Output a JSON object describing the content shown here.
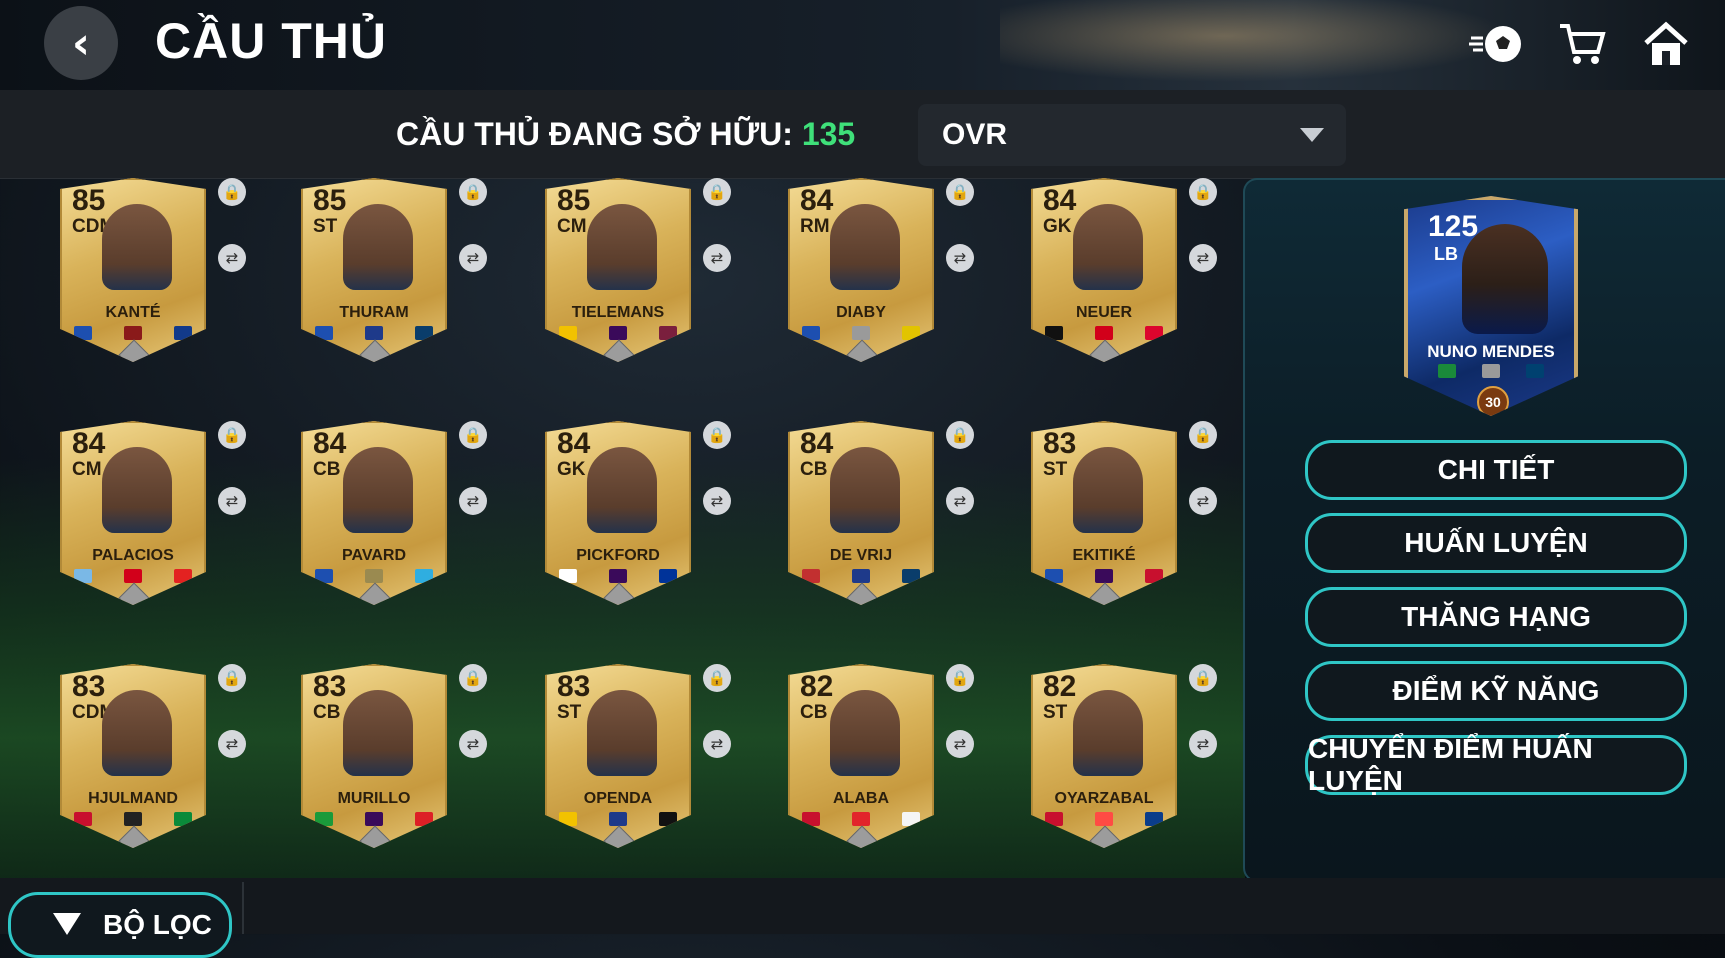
{
  "header": {
    "title": "CẦU THỦ",
    "back_icon": "‹",
    "icons": [
      "football-icon",
      "cart-icon",
      "home-icon"
    ]
  },
  "subbar": {
    "owned_label": "CẦU THỦ ĐANG SỞ HỮU: ",
    "owned_count": "135",
    "sort_value": "OVR"
  },
  "cards": [
    {
      "ovr": "85",
      "pos": "CDM",
      "name": "KANTÉ",
      "flag": "#1d4fb0"
    },
    {
      "ovr": "85",
      "pos": "ST",
      "name": "THURAM",
      "flag": "#1d4fb0"
    },
    {
      "ovr": "85",
      "pos": "CM",
      "name": "TIELEMANS",
      "flag": "#f2c200"
    },
    {
      "ovr": "84",
      "pos": "RM",
      "name": "DIABY",
      "flag": "#1d4fb0"
    },
    {
      "ovr": "84",
      "pos": "GK",
      "name": "NEUER",
      "flag": "#111111"
    },
    {
      "ovr": "84",
      "pos": "CM",
      "name": "PALACIOS",
      "flag": "#7ab8e6"
    },
    {
      "ovr": "84",
      "pos": "CB",
      "name": "PAVARD",
      "flag": "#1d4fb0"
    },
    {
      "ovr": "84",
      "pos": "GK",
      "name": "PICKFORD",
      "flag": "#ffffff"
    },
    {
      "ovr": "84",
      "pos": "CB",
      "name": "DE VRIJ",
      "flag": "#c23030"
    },
    {
      "ovr": "83",
      "pos": "ST",
      "name": "EKITIKÉ",
      "flag": "#1d4fb0"
    },
    {
      "ovr": "83",
      "pos": "CDM",
      "name": "HJULMAND",
      "flag": "#c8102e"
    },
    {
      "ovr": "83",
      "pos": "CB",
      "name": "MURILLO",
      "flag": "#1a9a3a"
    },
    {
      "ovr": "83",
      "pos": "ST",
      "name": "OPENDA",
      "flag": "#f2c200"
    },
    {
      "ovr": "82",
      "pos": "CB",
      "name": "ALABA",
      "flag": "#c8102e"
    },
    {
      "ovr": "82",
      "pos": "ST",
      "name": "OYARZABAL",
      "flag": "#c8102e"
    }
  ],
  "selected": {
    "ovr": "125",
    "pos": "LB",
    "name": "NUNO MENDES",
    "level": "30",
    "flag": "#1a8a3a"
  },
  "actions": [
    "CHI TIẾT",
    "HUẤN LUYỆN",
    "THĂNG HẠNG",
    "ĐIỂM KỸ NĂNG",
    "CHUYỂN ĐIỂM HUẤN LUYỆN"
  ],
  "footer": {
    "filter_label": "BỘ LỌC"
  },
  "colors": {
    "accent": "#2fc6c6",
    "count_green": "#3fe07a",
    "card_gold": "#d9b35a"
  }
}
